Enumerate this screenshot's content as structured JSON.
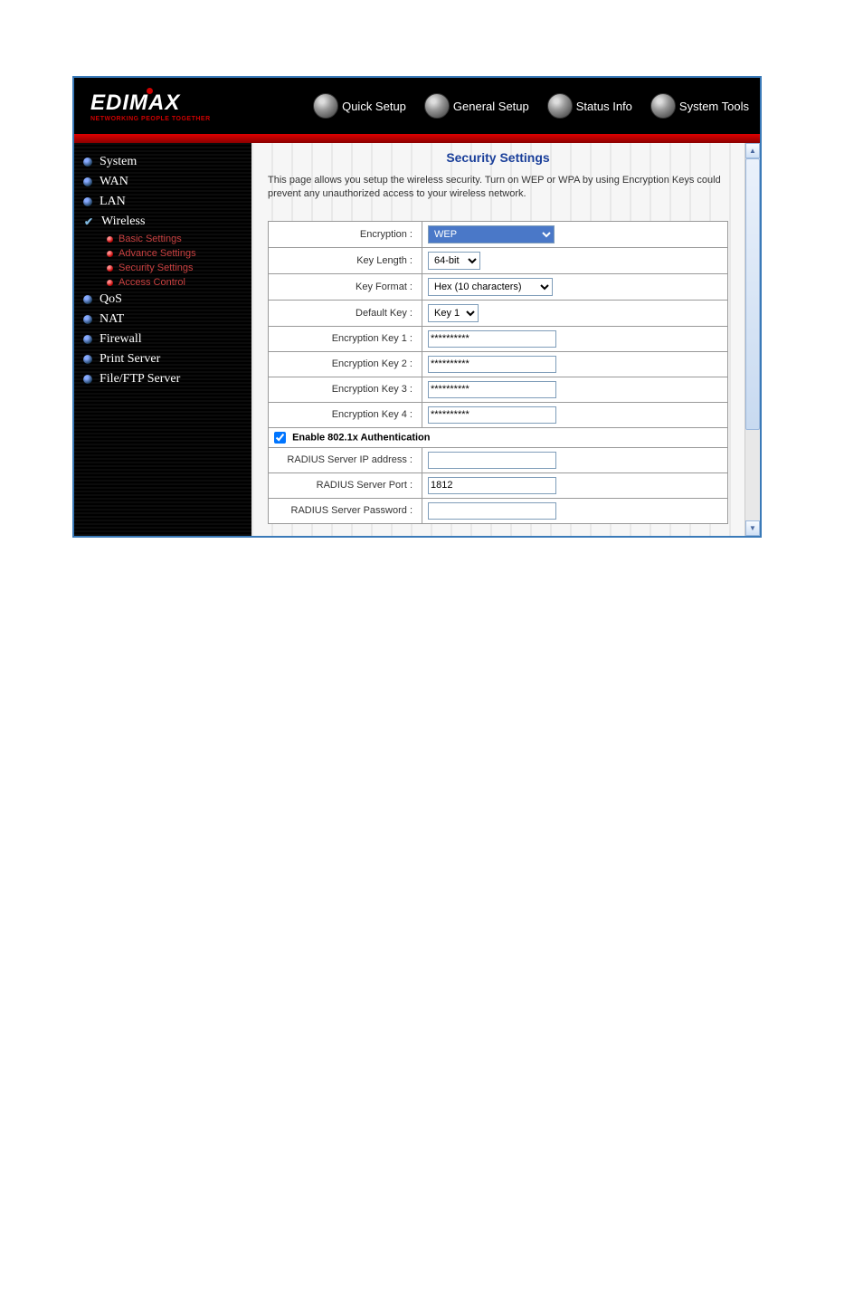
{
  "brand": {
    "name": "EDIMAX",
    "tagline": "NETWORKING PEOPLE TOGETHER"
  },
  "topnav": [
    {
      "label": "Quick Setup"
    },
    {
      "label": "General Setup"
    },
    {
      "label": "Status Info"
    },
    {
      "label": "System Tools"
    }
  ],
  "sidebar": {
    "items": [
      {
        "label": "System",
        "type": "bullet"
      },
      {
        "label": "WAN",
        "type": "bullet"
      },
      {
        "label": "LAN",
        "type": "bullet"
      },
      {
        "label": "Wireless",
        "type": "check",
        "children": [
          {
            "label": "Basic Settings"
          },
          {
            "label": "Advance Settings"
          },
          {
            "label": "Security Settings"
          },
          {
            "label": "Access Control"
          }
        ]
      },
      {
        "label": "QoS",
        "type": "bullet"
      },
      {
        "label": "NAT",
        "type": "bullet"
      },
      {
        "label": "Firewall",
        "type": "bullet"
      },
      {
        "label": "Print Server",
        "type": "bullet"
      },
      {
        "label": "File/FTP Server",
        "type": "bullet"
      }
    ]
  },
  "page": {
    "title": "Security Settings",
    "description": "This page allows you setup the wireless security. Turn on WEP or WPA by using Encryption Keys could prevent any unauthorized access to your wireless network."
  },
  "form": {
    "encryption": {
      "label": "Encryption :",
      "value": "WEP"
    },
    "key_length": {
      "label": "Key Length :",
      "value": "64-bit"
    },
    "key_format": {
      "label": "Key Format :",
      "value": "Hex (10 characters)"
    },
    "default_key": {
      "label": "Default Key :",
      "value": "Key 1"
    },
    "enc_key1": {
      "label": "Encryption Key 1 :",
      "value": "**********"
    },
    "enc_key2": {
      "label": "Encryption Key 2 :",
      "value": "**********"
    },
    "enc_key3": {
      "label": "Encryption Key 3 :",
      "value": "**********"
    },
    "enc_key4": {
      "label": "Encryption Key 4 :",
      "value": "**********"
    },
    "auth_section": {
      "label": "Enable 802.1x Authentication"
    },
    "radius_ip": {
      "label": "RADIUS Server IP address :",
      "value": ""
    },
    "radius_port": {
      "label": "RADIUS Server Port :",
      "value": "1812"
    },
    "radius_pwd": {
      "label": "RADIUS Server Password :",
      "value": ""
    }
  }
}
